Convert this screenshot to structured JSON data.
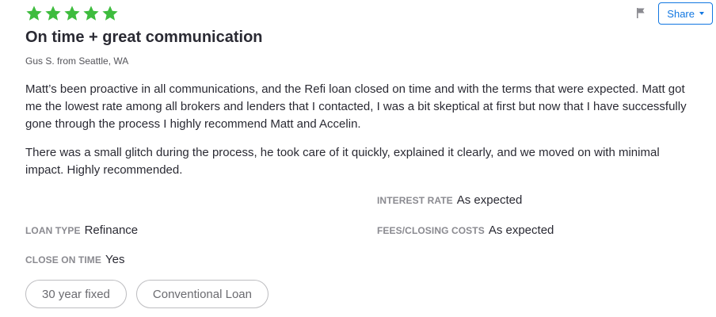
{
  "review": {
    "rating": 5,
    "star_color": "#3ebc3e",
    "title": "On time + great communication",
    "author": "Gus S. from Seattle, WA",
    "paragraphs": [
      "Matt’s been proactive in all communications, and the Refi loan closed on time and with the terms that were expected. Matt got me the lowest rate among all brokers and lenders that I contacted, I was a bit skeptical at first but now that I have successfully gone through the process I highly recommend Matt and Accelin.",
      "There was a small glitch during the process, he took care of it quickly, explained it clearly, and we moved on with minimal impact. Highly recommended."
    ]
  },
  "actions": {
    "flag_icon": "flag-icon",
    "share_label": "Share",
    "accent": "#1277e1"
  },
  "details": {
    "interest_rate": {
      "label": "Interest rate",
      "value": "As expected"
    },
    "loan_type": {
      "label": "Loan type",
      "value": "Refinance"
    },
    "fees": {
      "label": "Fees/closing costs",
      "value": "As expected"
    },
    "close_on_time": {
      "label": "Close on time",
      "value": "Yes"
    }
  },
  "tags": [
    "30 year fixed",
    "Conventional Loan"
  ]
}
